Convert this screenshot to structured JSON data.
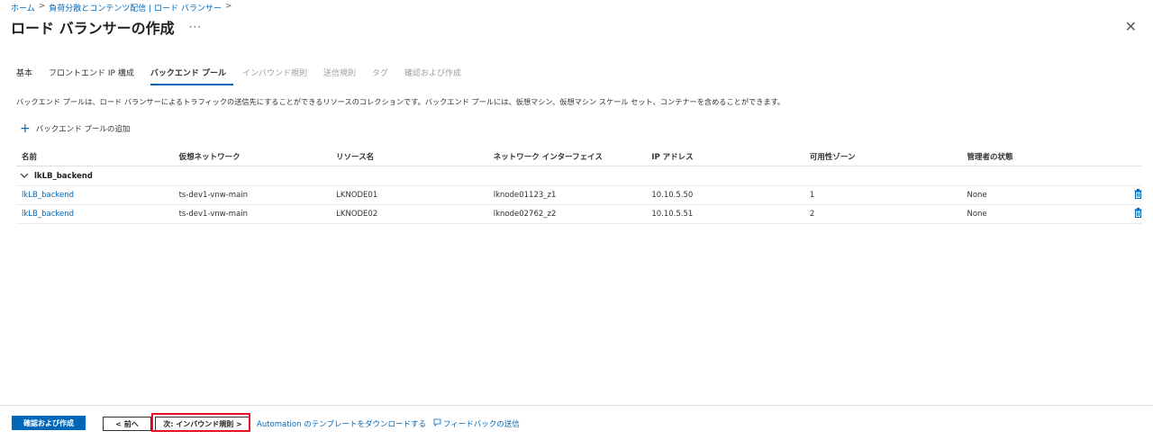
{
  "breadcrumb": [
    "ホーム",
    "負荷分散とコンテンツ配信 | ロード バランサー"
  ],
  "breadcrumb_sep": ">",
  "title": "ロード バランサーの作成",
  "more_glyph": "···",
  "close_glyph": "✕",
  "tabs": [
    {
      "label": "基本",
      "state": "normal"
    },
    {
      "label": "フロントエンド IP 構成",
      "state": "normal"
    },
    {
      "label": "バックエンド プール",
      "state": "active"
    },
    {
      "label": "インバウンド規則",
      "state": "disabled"
    },
    {
      "label": "送信規則",
      "state": "disabled"
    },
    {
      "label": "タグ",
      "state": "disabled"
    },
    {
      "label": "確認および作成",
      "state": "disabled"
    }
  ],
  "description": "バックエンド プールは、ロード バランサーによるトラフィックの送信先にすることができるリソースのコレクションです。バックエンド プールには、仮想マシン、仮想マシン スケール セット、コンテナーを含めることができます。",
  "add_pool_label": "バックエンド プールの追加",
  "table": {
    "headers": [
      "名前",
      "仮想ネットワーク",
      "リソース名",
      "ネットワーク インターフェイス",
      "IP アドレス",
      "可用性ゾーン",
      "管理者の状態"
    ],
    "group_label": "lkLB_backend",
    "rows": [
      [
        "lkLB_backend",
        "ts-dev1-vnw-main",
        "LKNODE01",
        "lknode01123_z1",
        "10.10.5.50",
        "1",
        "None"
      ],
      [
        "lkLB_backend",
        "ts-dev1-vnw-main",
        "LKNODE02",
        "lknode02762_z2",
        "10.10.5.51",
        "2",
        "None"
      ]
    ]
  },
  "footer": {
    "review_create": "確認および作成",
    "prev": "< 前へ",
    "next": "次: インバウンド規則 >",
    "automation_link": "Automation のテンプレートをダウンロードする",
    "feedback_link": "フィードバックの送信"
  },
  "colors": {
    "accent": "#0067b8",
    "highlight": "#e81123"
  }
}
